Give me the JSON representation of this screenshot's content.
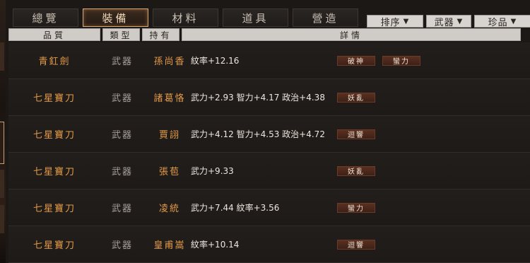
{
  "tabs": [
    {
      "label": "總覽",
      "active": false
    },
    {
      "label": "裝備",
      "active": true
    },
    {
      "label": "材料",
      "active": false
    },
    {
      "label": "道具",
      "active": false
    },
    {
      "label": "營造",
      "active": false
    }
  ],
  "filters": [
    {
      "label": "排序",
      "arrow": "▼"
    },
    {
      "label": "武器",
      "arrow": "▼"
    },
    {
      "label": "珍品",
      "arrow": "▼"
    }
  ],
  "columns": {
    "quality": "品質",
    "type": "類型",
    "holder": "持有",
    "detail": "詳情"
  },
  "rows": [
    {
      "quality": "青釭劍",
      "type": "武器",
      "holder": "孫尚香",
      "detail": "紋率+12.16",
      "tags": [
        "破神",
        "蠻力"
      ]
    },
    {
      "quality": "七星寶刀",
      "type": "武器",
      "holder": "諸葛恪",
      "detail": "武力+2.93  智力+4.17  政治+4.38",
      "tags": [
        "妖亂"
      ]
    },
    {
      "quality": "七星寶刀",
      "type": "武器",
      "holder": "賈詡",
      "detail": "武力+4.12  智力+4.53  政治+4.72",
      "tags": [
        "迴響"
      ]
    },
    {
      "quality": "七星寶刀",
      "type": "武器",
      "holder": "張苞",
      "detail": "武力+9.33",
      "tags": [
        "妖亂"
      ]
    },
    {
      "quality": "七星寶刀",
      "type": "武器",
      "holder": "凌統",
      "detail": "武力+7.44  紋率+3.56",
      "tags": [
        "蠻力"
      ]
    },
    {
      "quality": "七星寶刀",
      "type": "武器",
      "holder": "皇甫嵩",
      "detail": "紋率+10.14",
      "tags": [
        "迴響"
      ]
    }
  ]
}
